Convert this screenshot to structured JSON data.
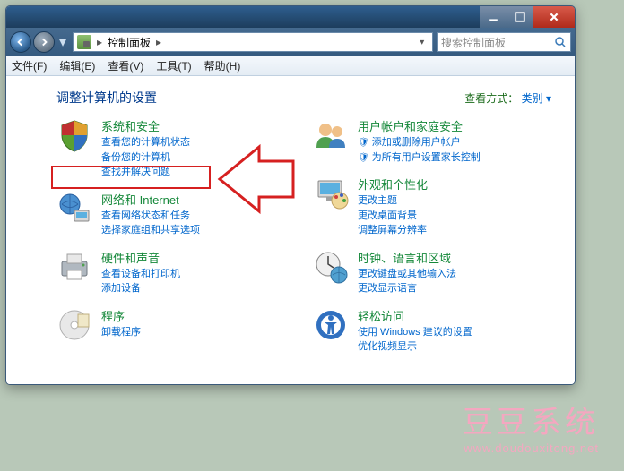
{
  "address": {
    "location": "控制面板"
  },
  "search": {
    "placeholder": "搜索控制面板"
  },
  "menu": {
    "file": "文件(F)",
    "edit": "编辑(E)",
    "view": "查看(V)",
    "tools": "工具(T)",
    "help": "帮助(H)"
  },
  "page": {
    "title": "调整计算机的设置",
    "viewby_label": "查看方式：",
    "viewby_value": "类别 ▾"
  },
  "left": [
    {
      "title": "系统和安全",
      "links": [
        "查看您的计算机状态",
        "备份您的计算机",
        "查找并解决问题"
      ]
    },
    {
      "title": "网络和 Internet",
      "links": [
        "查看网络状态和任务",
        "选择家庭组和共享选项"
      ]
    },
    {
      "title": "硬件和声音",
      "links": [
        "查看设备和打印机",
        "添加设备"
      ]
    },
    {
      "title": "程序",
      "links": [
        "卸载程序"
      ]
    }
  ],
  "right": [
    {
      "title": "用户帐户和家庭安全",
      "links": [
        "添加或删除用户帐户",
        "为所有用户设置家长控制"
      ],
      "shield": [
        true,
        true
      ]
    },
    {
      "title": "外观和个性化",
      "links": [
        "更改主题",
        "更改桌面背景",
        "调整屏幕分辨率"
      ]
    },
    {
      "title": "时钟、语言和区域",
      "links": [
        "更改键盘或其他输入法",
        "更改显示语言"
      ]
    },
    {
      "title": "轻松访问",
      "links": [
        "使用 Windows 建议的设置",
        "优化视频显示"
      ]
    }
  ],
  "watermark": {
    "text": "豆豆系统",
    "url": "www.doudouxitong.net"
  }
}
